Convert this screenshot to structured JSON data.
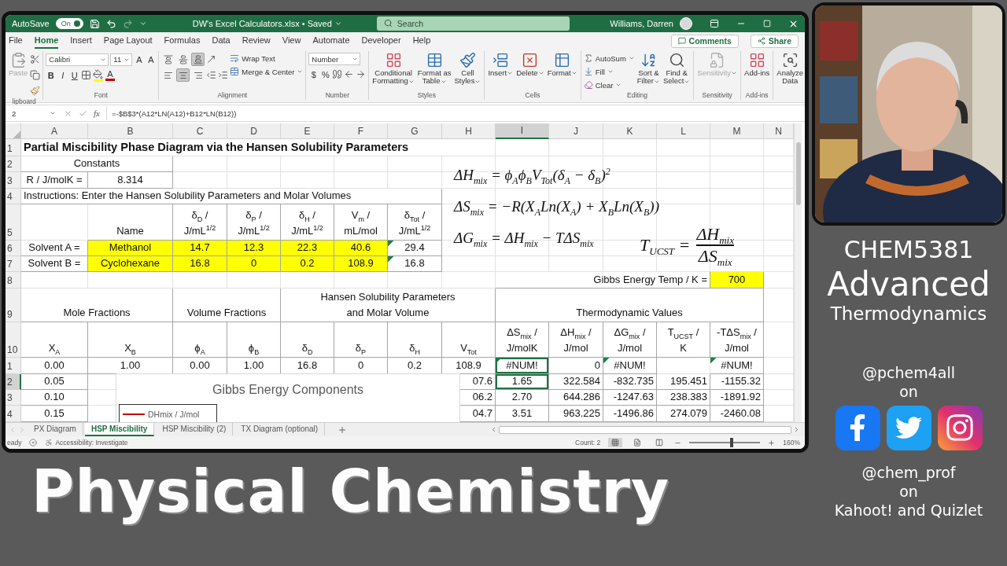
{
  "title_bar": {
    "autosave_label": "AutoSave",
    "autosave_toggle": {
      "label": "On",
      "on": true
    },
    "document_title": "DW's Excel Calculators.xlsx • Saved",
    "search": {
      "placeholder": "Search"
    },
    "user_name": "Williams, Darren"
  },
  "menu_tabs": [
    {
      "label": "File",
      "selected": false
    },
    {
      "label": "Home",
      "selected": true
    },
    {
      "label": "Insert",
      "selected": false
    },
    {
      "label": "Page Layout",
      "selected": false
    },
    {
      "label": "Formulas",
      "selected": false
    },
    {
      "label": "Data",
      "selected": false
    },
    {
      "label": "Review",
      "selected": false
    },
    {
      "label": "View",
      "selected": false
    },
    {
      "label": "Automate",
      "selected": false
    },
    {
      "label": "Developer",
      "selected": false
    },
    {
      "label": "Help",
      "selected": false
    }
  ],
  "actions": [
    "Comments",
    "Share"
  ],
  "ribbon": [
    {
      "label": "lipboard",
      "blocks": [
        {
          "kind": "large",
          "label": "Paste",
          "disabled": true
        },
        {
          "kind": "rows",
          "rows": [
            {
              "items": [
                {
                  "kind": "icon"
                }
              ]
            },
            {
              "items": [
                {
                  "kind": "icon"
                }
              ]
            },
            {
              "items": [
                {
                  "kind": "icon"
                }
              ]
            }
          ]
        }
      ]
    },
    {
      "label": "Font",
      "blocks": [
        {
          "kind": "rows",
          "rows": [
            {
              "items": [
                {
                  "kind": "field",
                  "value": "Calibri"
                },
                {
                  "kind": "field",
                  "value": "11"
                },
                {
                  "kind": "glyph",
                  "label": "A"
                },
                {
                  "kind": "glyph",
                  "label": "A"
                }
              ]
            },
            {
              "items": [
                {
                  "kind": "bold",
                  "label": "B"
                },
                {
                  "kind": "italic",
                  "label": "I"
                },
                {
                  "kind": "underline",
                  "label": "U"
                },
                {
                  "kind": "icon"
                },
                {
                  "kind": "icon",
                  "color": "#ffff00"
                },
                {
                  "kind": "glyph",
                  "label": "A",
                  "color": "#c00000"
                }
              ]
            }
          ]
        }
      ]
    },
    {
      "label": "Alignment",
      "blocks": [
        {
          "kind": "rows",
          "rows": [
            {
              "items": [
                {
                  "kind": "toggle",
                  "selected": false
                },
                {
                  "kind": "toggle",
                  "selected": false
                },
                {
                  "kind": "toggle",
                  "selected": true
                },
                {
                  "kind": "icon"
                }
              ]
            },
            {
              "items": [
                {
                  "kind": "toggle",
                  "selected": false
                },
                {
                  "kind": "toggle",
                  "selected": true
                },
                {
                  "kind": "toggle",
                  "selected": false
                },
                {
                  "kind": "icon"
                },
                {
                  "kind": "icon"
                }
              ]
            }
          ]
        },
        {
          "kind": "rows",
          "rows": [
            {
              "items": [
                {
                  "kind": "small",
                  "label": "Wrap Text"
                }
              ]
            },
            {
              "items": [
                {
                  "kind": "small",
                  "label": "Merge & Center",
                  "dropdown": true
                }
              ]
            }
          ]
        }
      ]
    },
    {
      "label": "Number",
      "blocks": [
        {
          "kind": "rows",
          "rows": [
            {
              "items": [
                {
                  "kind": "field",
                  "value": "Number"
                }
              ]
            },
            {
              "items": [
                {
                  "kind": "glyph",
                  "label": "$"
                },
                {
                  "kind": "glyph",
                  "label": "%"
                },
                {
                  "kind": "icon"
                },
                {
                  "kind": "icon"
                },
                {
                  "kind": "icon"
                }
              ]
            }
          ]
        }
      ]
    },
    {
      "label": "Styles",
      "blocks": [
        {
          "kind": "large",
          "label": "Conditional\nFormatting",
          "dropdown": true
        },
        {
          "kind": "large",
          "label": "Format as\nTable",
          "dropdown": true
        },
        {
          "kind": "large",
          "label": "Cell\nStyles",
          "dropdown": true
        }
      ]
    },
    {
      "label": "Cells",
      "blocks": [
        {
          "kind": "large",
          "label": "Insert",
          "dropdown": true
        },
        {
          "kind": "large",
          "label": "Delete",
          "dropdown": true
        },
        {
          "kind": "large",
          "label": "Format",
          "dropdown": true
        }
      ]
    },
    {
      "label": "Editing",
      "blocks": [
        {
          "kind": "rows",
          "rows": [
            {
              "items": [
                {
                  "kind": "small",
                  "label": "AutoSum",
                  "dropdown": true
                }
              ]
            },
            {
              "items": [
                {
                  "kind": "small",
                  "label": "Fill",
                  "dropdown": true
                }
              ]
            },
            {
              "items": [
                {
                  "kind": "small",
                  "label": "Clear",
                  "dropdown": true
                }
              ]
            }
          ]
        },
        {
          "kind": "large",
          "label": "Sort &\nFilter",
          "dropdown": true
        },
        {
          "kind": "large",
          "label": "Find &\nSelect",
          "dropdown": true
        }
      ]
    },
    {
      "label": "Sensitivity",
      "blocks": [
        {
          "kind": "large",
          "label": "Sensitivity",
          "disabled": true,
          "dropdown": true
        }
      ]
    },
    {
      "label": "Add-ins",
      "blocks": [
        {
          "kind": "large",
          "label": "Add-ins"
        }
      ]
    },
    {
      "blocks": [
        {
          "kind": "large",
          "label": "Analyze\nData"
        }
      ]
    }
  ],
  "formula_bar": {
    "name_box": "2",
    "fx": "fx",
    "formula": "=-$B$3*(A12*LN(A12)+B12*LN(B12))"
  },
  "sheet": {
    "columns": [
      {
        "label": "A",
        "selected": false
      },
      {
        "label": "B",
        "selected": false
      },
      {
        "label": "C",
        "selected": false
      },
      {
        "label": "D",
        "selected": false
      },
      {
        "label": "E",
        "selected": false
      },
      {
        "label": "F",
        "selected": false
      },
      {
        "label": "G",
        "selected": false
      },
      {
        "label": "H",
        "selected": false
      },
      {
        "label": "I",
        "selected": true
      },
      {
        "label": "J",
        "selected": false
      },
      {
        "label": "K",
        "selected": false
      },
      {
        "label": "L",
        "selected": false
      },
      {
        "label": "M",
        "selected": false
      },
      {
        "label": "N",
        "selected": false
      }
    ],
    "rows": [
      {
        "number": "1",
        "selected": false,
        "cells": [
          {
            "text": "Partial Miscibility Phase Diagram via the Hansen Solubility Parameters",
            "kind": "title",
            "colspan": 8,
            "selected": false,
            "flagged": false
          }
        ]
      },
      {
        "number": "2",
        "selected": false,
        "cells": [
          {
            "text": "Constants",
            "kind": "text",
            "colspan": 2,
            "selected": false,
            "flagged": false
          }
        ]
      },
      {
        "number": "3",
        "selected": false,
        "cells": [
          {
            "text": "R / J/molK =",
            "kind": "text",
            "selected": false,
            "flagged": false
          },
          {
            "text": "8.314",
            "kind": "text",
            "selected": false,
            "flagged": false
          }
        ]
      },
      {
        "number": "4",
        "selected": false,
        "cells": [
          {
            "text": "Instructions: Enter the Hansen Solubility Parameters and Molar Volumes",
            "kind": "note",
            "colspan": 7,
            "selected": false,
            "flagged": false
          }
        ]
      },
      {
        "number": "5",
        "selected": false,
        "cells": [
          null,
          {
            "text": "Name",
            "kind": "header",
            "selected": false,
            "flagged": false
          },
          {
            "text": "δ$_{D}$ /\nJ/mL$^{1/2}$",
            "kind": "header",
            "selected": false,
            "flagged": false
          },
          {
            "text": "δ$_{P}$ /\nJ/mL$^{1/2}$",
            "kind": "header",
            "selected": false,
            "flagged": false
          },
          {
            "text": "δ$_{H}$ /\nJ/mL$^{1/2}$",
            "kind": "header",
            "selected": false,
            "flagged": false
          },
          {
            "text": "V$_{m}$ /\nmL/mol",
            "kind": "header",
            "selected": false,
            "flagged": false
          },
          {
            "text": "δ$_{Tot}$ /\nJ/mL$^{1/2}$",
            "kind": "header",
            "selected": false,
            "flagged": false
          }
        ]
      },
      {
        "number": "6",
        "selected": false,
        "cells": [
          {
            "text": "Solvent A =",
            "kind": "text",
            "selected": false,
            "flagged": false
          },
          {
            "text": "Methanol",
            "kind": "input",
            "selected": false,
            "flagged": false
          },
          {
            "text": "14.7",
            "kind": "input",
            "selected": false,
            "flagged": false
          },
          {
            "text": "12.3",
            "kind": "input",
            "selected": false,
            "flagged": false
          },
          {
            "text": "22.3",
            "kind": "input",
            "selected": false,
            "flagged": false
          },
          {
            "text": "40.6",
            "kind": "input",
            "selected": false,
            "flagged": false
          },
          {
            "text": "29.4",
            "kind": "text",
            "selected": false,
            "flagged": true
          }
        ]
      },
      {
        "number": "7",
        "selected": false,
        "cells": [
          {
            "text": "Solvent B =",
            "kind": "text",
            "selected": false,
            "flagged": false
          },
          {
            "text": "Cyclohexane",
            "kind": "input",
            "selected": false,
            "flagged": false
          },
          {
            "text": "16.8",
            "kind": "input",
            "selected": false,
            "flagged": false
          },
          {
            "text": "0",
            "kind": "input",
            "selected": false,
            "flagged": false
          },
          {
            "text": "0.2",
            "kind": "input",
            "selected": false,
            "flagged": false
          },
          {
            "text": "108.9",
            "kind": "input",
            "selected": false,
            "flagged": false
          },
          {
            "text": "16.8",
            "kind": "text",
            "selected": false,
            "flagged": true
          }
        ]
      },
      {
        "number": "8",
        "selected": false,
        "cells": [
          null,
          null,
          null,
          null,
          null,
          null,
          null,
          null,
          {
            "text": "Gibbs Energy Temp / K =",
            "kind": "label",
            "colspan": 4,
            "selected": false,
            "flagged": false
          },
          {
            "text": "700",
            "kind": "input",
            "selected": false,
            "flagged": false
          }
        ]
      },
      {
        "number": "9",
        "selected": false,
        "cells": [
          {
            "text": "Mole Fractions",
            "kind": "header",
            "colspan": 2,
            "selected": false,
            "flagged": false
          },
          {
            "text": "Volume Fractions",
            "kind": "header",
            "colspan": 2,
            "selected": false,
            "flagged": false
          },
          {
            "text": "Hansen Solubility Parameters\nand Molar Volume",
            "kind": "header",
            "colspan": 4,
            "selected": false,
            "flagged": false
          },
          {
            "text": "Thermodynamic Values",
            "kind": "header",
            "colspan": 5,
            "selected": false,
            "flagged": false
          }
        ]
      },
      {
        "number": "10",
        "selected": false,
        "cells": [
          {
            "text": "X$_{A}$",
            "kind": "header",
            "selected": false,
            "flagged": false
          },
          {
            "text": "X$_{B}$",
            "kind": "header",
            "selected": false,
            "flagged": false
          },
          {
            "text": "ϕ$_{A}$",
            "kind": "header",
            "selected": false,
            "flagged": false
          },
          {
            "text": "ϕ$_{B}$",
            "kind": "header",
            "selected": false,
            "flagged": false
          },
          {
            "text": "δ$_{D}$",
            "kind": "header",
            "selected": false,
            "flagged": false
          },
          {
            "text": "δ$_{P}$",
            "kind": "header",
            "selected": false,
            "flagged": false
          },
          {
            "text": "δ$_{H}$",
            "kind": "header",
            "selected": false,
            "flagged": false
          },
          {
            "text": "V$_{Tot}$",
            "kind": "header",
            "selected": false,
            "flagged": false
          },
          {
            "text": "ΔS$_{mix}$ /\nJ/molK",
            "kind": "header",
            "selected": false,
            "flagged": false
          },
          {
            "text": "ΔH$_{mix}$ /\nJ/mol",
            "kind": "header",
            "selected": false,
            "flagged": false
          },
          {
            "text": "ΔG$_{mix}$ /\nJ/mol",
            "kind": "header",
            "selected": false,
            "flagged": false
          },
          {
            "text": "T$_{UCST}$ /\nK",
            "kind": "header",
            "selected": false,
            "flagged": false
          },
          {
            "text": "-TΔS$_{mix}$ /\nJ/mol",
            "kind": "header",
            "selected": false,
            "flagged": false
          }
        ]
      },
      {
        "number": "1",
        "selected": false,
        "cells": [
          {
            "text": "0.00",
            "kind": "value",
            "selected": false,
            "flagged": false
          },
          {
            "text": "1.00",
            "kind": "value",
            "selected": false,
            "flagged": false
          },
          {
            "text": "0.00",
            "kind": "value",
            "selected": false,
            "flagged": false
          },
          {
            "text": "1.00",
            "kind": "value",
            "selected": false,
            "flagged": false
          },
          {
            "text": "16.8",
            "kind": "value",
            "selected": false,
            "flagged": false
          },
          {
            "text": "0",
            "kind": "value",
            "selected": false,
            "flagged": false
          },
          {
            "text": "0.2",
            "kind": "value",
            "selected": false,
            "flagged": false
          },
          {
            "text": "108.9",
            "kind": "value",
            "selected": false,
            "flagged": false
          },
          {
            "text": "#NUM!",
            "kind": "error",
            "selected": true,
            "flagged": true
          },
          {
            "text": "0",
            "kind": "number",
            "selected": false,
            "flagged": false
          },
          {
            "text": "#NUM!",
            "kind": "error",
            "selected": false,
            "flagged": true
          },
          null,
          {
            "text": "#NUM!",
            "kind": "error",
            "selected": false,
            "flagged": true
          }
        ]
      },
      {
        "number": "2",
        "selected": true,
        "cells": [
          {
            "text": "0.05",
            "kind": "value",
            "selected": false,
            "flagged": false
          },
          null,
          null,
          null,
          null,
          null,
          null,
          {
            "text": "07.6",
            "kind": "number"
          },
          {
            "text": "1.65",
            "kind": "value",
            "selected": true,
            "flagged": false
          },
          {
            "text": "322.584",
            "kind": "number",
            "selected": false,
            "flagged": false
          },
          {
            "text": "-832.735",
            "kind": "number",
            "selected": false,
            "flagged": false
          },
          {
            "text": "195.451",
            "kind": "number",
            "selected": false,
            "flagged": false
          },
          {
            "text": "-1155.32",
            "kind": "number",
            "selected": false,
            "flagged": false
          }
        ]
      },
      {
        "number": "3",
        "selected": false,
        "cells": [
          {
            "text": "0.10",
            "kind": "value",
            "selected": false,
            "flagged": false
          },
          null,
          null,
          null,
          null,
          null,
          null,
          {
            "text": "06.2",
            "kind": "number"
          },
          {
            "text": "2.70",
            "kind": "value",
            "selected": false,
            "flagged": false
          },
          {
            "text": "644.286",
            "kind": "number",
            "selected": false,
            "flagged": false
          },
          {
            "text": "-1247.63",
            "kind": "number",
            "selected": false,
            "flagged": false
          },
          {
            "text": "238.383",
            "kind": "number",
            "selected": false,
            "flagged": false
          },
          {
            "text": "-1891.92",
            "kind": "number",
            "selected": false,
            "flagged": false
          }
        ]
      },
      {
        "number": "4",
        "selected": false,
        "cells": [
          {
            "text": "0.15",
            "kind": "value",
            "selected": false,
            "flagged": false
          },
          null,
          null,
          null,
          null,
          null,
          null,
          {
            "text": "04.7",
            "kind": "number"
          },
          {
            "text": "3.51",
            "kind": "value",
            "selected": false,
            "flagged": false
          },
          {
            "text": "963.225",
            "kind": "number",
            "selected": false,
            "flagged": false
          },
          {
            "text": "-1496.86",
            "kind": "number",
            "selected": false,
            "flagged": false
          },
          {
            "text": "274.079",
            "kind": "number",
            "selected": false,
            "flagged": false
          },
          {
            "text": "-2460.08",
            "kind": "number",
            "selected": false,
            "flagged": false
          }
        ]
      }
    ]
  },
  "equations": [
    {
      "kind": "line",
      "text": "ΔH$_{mix}$ = ϕ$_{A}$ϕ$_{B}$V$_{Tot}$(δ$_{A}$ − δ$_{B}$)$^{2}$"
    },
    {
      "kind": "line",
      "text": "ΔS$_{mix}$ = −R(X$_{A}$Ln(X$_{A}$) + X$_{B}$Ln(X$_{B}$))"
    },
    {
      "kind": "line",
      "text": "ΔG$_{mix}$ = ΔH$_{mix}$ − TΔS$_{mix}$"
    },
    {
      "kind": "fraction",
      "lhs": "T$_{UCST}$ =",
      "numerator": "ΔH$_{mix}$",
      "denominator": "ΔS$_{mix}$"
    }
  ],
  "chart": {
    "title": "Gibbs Energy Components",
    "legend": [
      {
        "label": "DHmix / J/mol",
        "color": "#c00000"
      }
    ]
  },
  "sheet_tabs": [
    {
      "label": "PX Diagram",
      "selected": false
    },
    {
      "label": "HSP Miscibility",
      "selected": true
    },
    {
      "label": "HSP Miscibility (2)",
      "selected": false
    },
    {
      "label": "TX Diagram (optional)",
      "selected": false
    }
  ],
  "status_bar": {
    "mode": "eady",
    "accessibility": "Accessibility: Investigate",
    "count": "Count: 2",
    "views": [
      {
        "selected": true
      },
      {
        "selected": false
      },
      {
        "selected": false
      }
    ],
    "zoom": {
      "level": 0.6,
      "reading": "160%"
    }
  },
  "side_panel": {
    "course_code": "CHEM5381",
    "course_title": "Advanced",
    "course_subtitle": "Thermodynamics",
    "handle_1": "@pchem4all",
    "on_1": "on",
    "handle_2": "@chem_prof",
    "on_2": "on",
    "platforms": "Kahoot! and Quizlet"
  },
  "banner": "Physical Chemistry"
}
